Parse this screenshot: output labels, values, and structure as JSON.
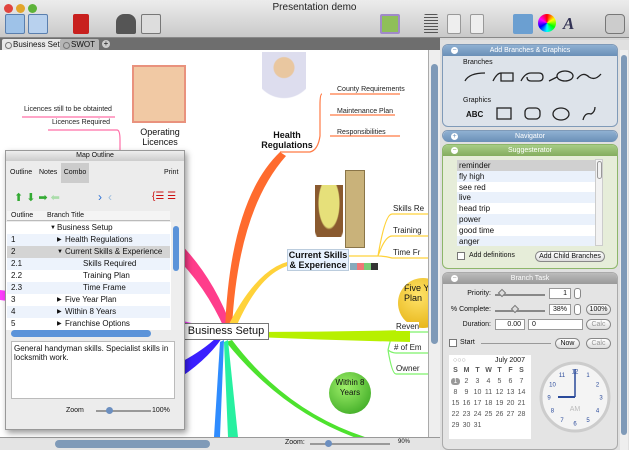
{
  "window": {
    "title": "Presentation demo"
  },
  "toolbar": {
    "icons": [
      "map-view-icon",
      "topic-view-icon",
      "presentation-icon",
      "contacts-icon",
      "resources-icon",
      "insert-image-icon",
      "outline-icon",
      "info-icon",
      "notes-icon",
      "media-icon",
      "colors-icon",
      "fonts-icon",
      "print-icon"
    ]
  },
  "tabs": [
    {
      "label": "Business Setup",
      "active": true
    },
    {
      "label": "SWOT",
      "active": false
    }
  ],
  "map": {
    "central": "Business Setup",
    "operating_licences": {
      "title": "Operating Licences",
      "leaves": [
        "Licences Required",
        "Licences still to be obtainted"
      ]
    },
    "health": {
      "title": "Health Regulations",
      "leaves": [
        "County Requirements",
        "Maintenance Plan",
        "Responsibilities"
      ]
    },
    "skills": {
      "title": "Current Skills & Experience",
      "leaves": [
        "Skills Re",
        "Training",
        "Time Fr"
      ]
    },
    "five_year": {
      "title": "Five Year Plan"
    },
    "within8": {
      "title": "Within 8 Years",
      "leaves": [
        "Reven",
        "# of Em",
        "Owner"
      ]
    },
    "colors": {
      "pink": "#ff3d8b",
      "orange": "#ff6b2e",
      "yellow": "#ffd23a",
      "lime": "#b7f000",
      "green": "#4de22e",
      "teal": "#27f0a0",
      "blue": "#2f8cff",
      "indigo": "#3a1fff"
    }
  },
  "outline": {
    "title": "Map Outline",
    "tools": [
      "Outline",
      "Notes",
      "Combo"
    ],
    "print": "Print",
    "columns": [
      "Outline",
      "Branch Title"
    ],
    "rows": [
      {
        "num": "",
        "title": "Business Setup",
        "level": 0,
        "arrow": "▼"
      },
      {
        "num": "1",
        "title": "Health Regulations",
        "level": 1,
        "arrow": "▶"
      },
      {
        "num": "2",
        "title": "Current Skills & Experience",
        "level": 1,
        "arrow": "▼"
      },
      {
        "num": "2.1",
        "title": "Skills Required",
        "level": 2,
        "arrow": ""
      },
      {
        "num": "2.2",
        "title": "Training Plan",
        "level": 2,
        "arrow": ""
      },
      {
        "num": "2.3",
        "title": "Time Frame",
        "level": 2,
        "arrow": ""
      },
      {
        "num": "3",
        "title": "Five Year Plan",
        "level": 1,
        "arrow": "▶"
      },
      {
        "num": "4",
        "title": "Within 8 Years",
        "level": 1,
        "arrow": "▶"
      },
      {
        "num": "5",
        "title": "Franchise Options",
        "level": 1,
        "arrow": "▶"
      }
    ],
    "notes": "General handyman skills. Specialist skills in locksmith work.",
    "zoom_label": "Zoom",
    "zoom_value": "100%"
  },
  "bottom": {
    "zoom_label": "Zoom:",
    "zoom_value": "90%"
  },
  "panel": {
    "add_branches": {
      "title": "Add Branches & Graphics",
      "branches_label": "Branches",
      "graphics_label": "Graphics",
      "abc": "ABC"
    },
    "navigator": {
      "title": "Navigator"
    },
    "suggesterator": {
      "title": "Suggesterator",
      "items": [
        "reminder",
        "fly high",
        "see red",
        "live",
        "head trip",
        "power",
        "good time",
        "anger"
      ],
      "add_definitions": "Add definitions",
      "add_child": "Add Child Branches"
    },
    "task": {
      "title": "Branch Task",
      "priority_label": "Priority:",
      "priority": "1",
      "complete_label": "% Complete:",
      "complete": "38%",
      "complete_fraction": 0.38,
      "btn_100": "100%",
      "duration_label": "Duration:",
      "duration": "0.00",
      "duration_unit": "0",
      "calc": "Calc",
      "start_label": "Start",
      "now": "Now",
      "calendar": {
        "month": "July 2007",
        "days": [
          "S",
          "M",
          "T",
          "W",
          "T",
          "F",
          "S"
        ],
        "weeks": [
          [
            "1",
            "2",
            "3",
            "4",
            "5",
            "6",
            "7"
          ],
          [
            "8",
            "9",
            "10",
            "11",
            "12",
            "13",
            "14"
          ],
          [
            "15",
            "16",
            "17",
            "18",
            "19",
            "20",
            "21"
          ],
          [
            "22",
            "23",
            "24",
            "25",
            "26",
            "27",
            "28"
          ],
          [
            "29",
            "30",
            "31"
          ]
        ]
      },
      "clock": {
        "ampm": "AM",
        "time": "9:00",
        "numbers": [
          "12",
          "1",
          "2",
          "3",
          "4",
          "5",
          "6",
          "7",
          "8",
          "9",
          "10",
          "11"
        ]
      }
    }
  }
}
